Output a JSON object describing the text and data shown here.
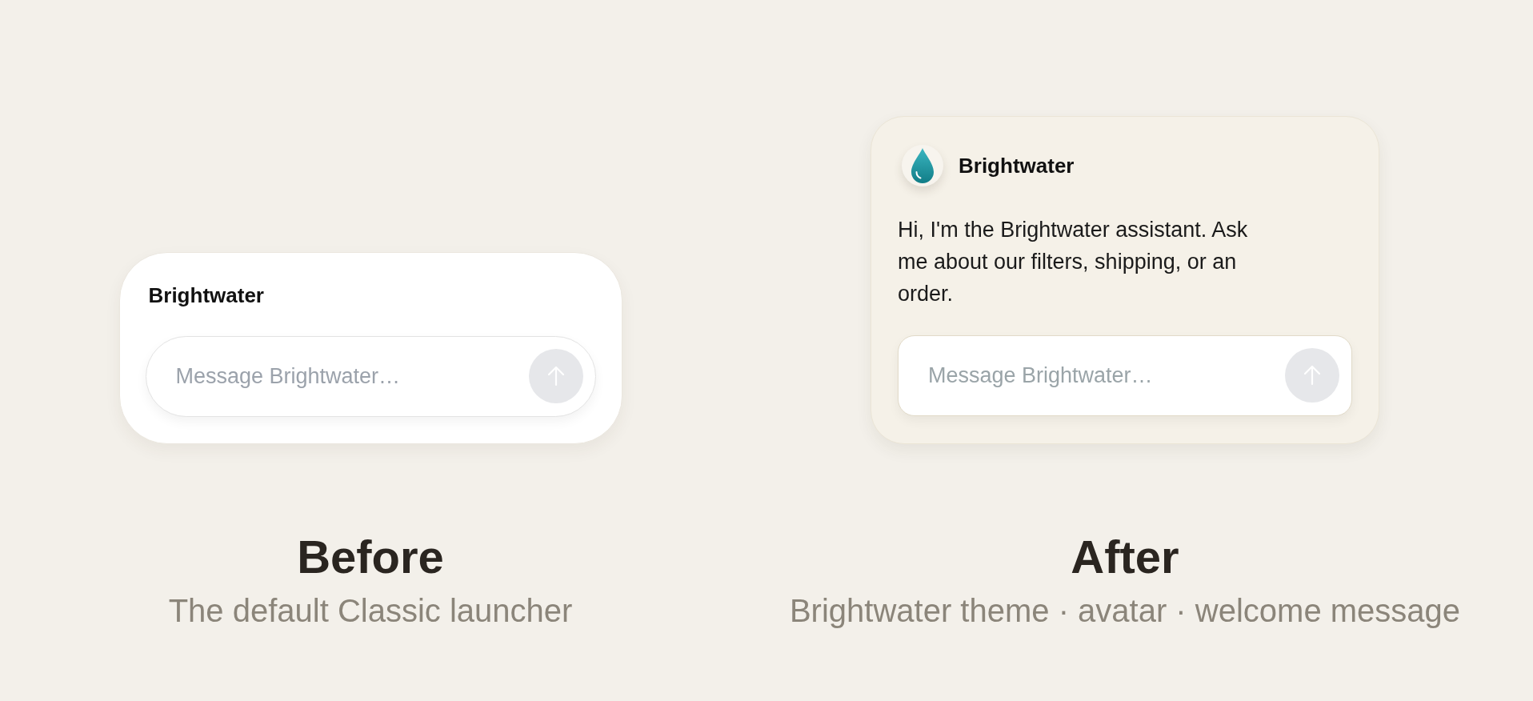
{
  "panels": [
    {
      "kind": "classic",
      "launcher": {
        "title": "Brightwater",
        "composer": {
          "placeholder": "Message Brightwater…",
          "send_button": {
            "disabled": true
          }
        }
      },
      "caption": {
        "title": "Before",
        "subtitle": "The default Classic launcher"
      }
    },
    {
      "kind": "themed",
      "launcher": {
        "title": "Brightwater",
        "welcome_message": "Hi, I'm the Brightwater assistant. Ask me about our filters, shipping, or an order.",
        "composer": {
          "placeholder": "Message Brightwater…",
          "send_button": {
            "disabled": true
          }
        }
      },
      "caption": {
        "title": "After",
        "subtitle": "Brightwater theme · avatar · welcome message"
      }
    }
  ]
}
